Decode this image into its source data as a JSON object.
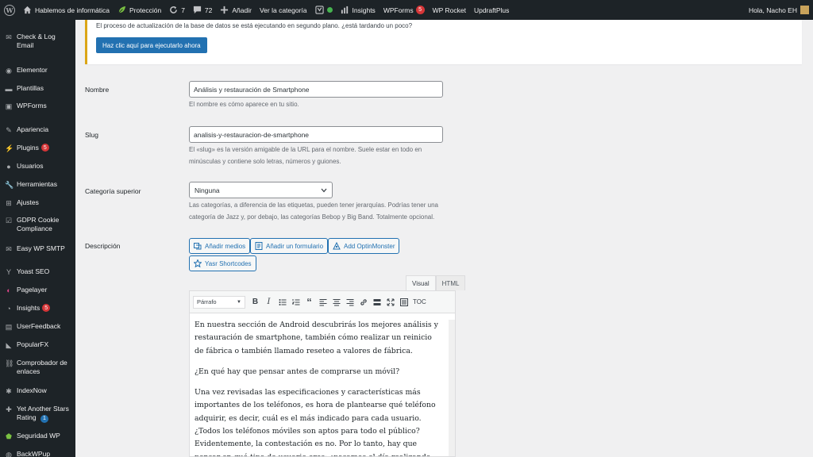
{
  "admin_bar": {
    "site_name": "Hablemos de informática",
    "protection": "Protección",
    "updates_count": "7",
    "comments_count": "72",
    "add_new": "Añadir",
    "view_category": "Ver la categoría",
    "insights": "Insights",
    "wpforms": "WPForms",
    "wpforms_badge": "5",
    "wprocket": "WP Rocket",
    "updraftplus": "UpdraftPlus",
    "greeting": "Hola, Nacho EH"
  },
  "sidebar": {
    "items": [
      {
        "label": "Check & Log Email"
      },
      {
        "label": "Elementor"
      },
      {
        "label": "Plantillas"
      },
      {
        "label": "WPForms"
      },
      {
        "label": "Apariencia"
      },
      {
        "label": "Plugins",
        "badge": "5"
      },
      {
        "label": "Usuarios"
      },
      {
        "label": "Herramientas"
      },
      {
        "label": "Ajustes"
      },
      {
        "label": "GDPR Cookie Compliance"
      },
      {
        "label": "Easy WP SMTP"
      },
      {
        "label": "Yoast SEO"
      },
      {
        "label": "Pagelayer"
      },
      {
        "label": "Insights",
        "badge": "5"
      },
      {
        "label": "UserFeedback"
      },
      {
        "label": "PopularFX"
      },
      {
        "label": "Comprobador de enlaces"
      },
      {
        "label": "IndexNow"
      },
      {
        "label": "Yet Another Stars Rating",
        "badge": "1"
      },
      {
        "label": "Seguridad WP"
      },
      {
        "label": "BackWPup"
      }
    ]
  },
  "notice": {
    "text": "El proceso de actualización de la base de datos se está ejecutando en segundo plano. ¿está tardando un poco?",
    "button": "Haz clic aquí para ejecutarlo ahora"
  },
  "form": {
    "name_label": "Nombre",
    "name_value": "Análisis y restauración de Smartphone",
    "name_desc": "El nombre es cómo aparece en tu sitio.",
    "slug_label": "Slug",
    "slug_value": "analisis-y-restauracion-de-smartphone",
    "slug_desc": "El «slug» es la versión amigable de la URL para el nombre. Suele estar en todo en minúsculas y contiene solo letras, números y guiones.",
    "parent_label": "Categoría superior",
    "parent_value": "Ninguna",
    "parent_desc": "Las categorías, a diferencia de las etiquetas, pueden tener jerarquías. Podrías tener una categoría de Jazz y, por debajo, las categorías Bebop y Big Band. Totalmente opcional.",
    "desc_label": "Descripción"
  },
  "editor": {
    "buttons": [
      "Añadir medios",
      "Añadir un formulario",
      "Add OptinMonster",
      "Yasr Shortcodes"
    ],
    "tab_visual": "Visual",
    "tab_html": "HTML",
    "format_select": "Párrafo",
    "toc_label": "TOC",
    "paragraphs": [
      "En nuestra sección de Android descubrirás los mejores análisis y restauración de smartphone, también cómo realizar un reinicio de fábrica o también llamado reseteo a valores de fábrica.",
      "¿En qué hay que pensar antes de comprarse un móvil?",
      "Una vez revisadas las especificaciones y características más importantes de los teléfonos, es hora de plantearse qué teléfono adquirir, es decir, cuál es el más indicado para cada usuario. ¿Todos los teléfonos móviles son aptos para todo el público? Evidentemente, la contestación es no. Por lo tanto, hay que pensar en qué tipo de usuario eres: ¿pasamos el día realizando"
    ]
  }
}
